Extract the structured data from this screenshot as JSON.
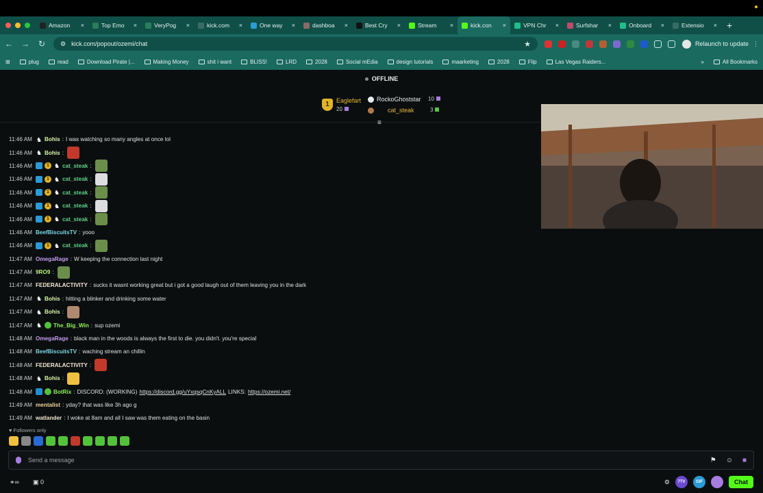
{
  "browser": {
    "tabs": [
      {
        "title": "Amazon",
        "favicon": "amazon-icon",
        "color": "#222222"
      },
      {
        "title": "Top Emo",
        "favicon": "video-icon",
        "color": "#2a7d5a"
      },
      {
        "title": "VeryPog",
        "favicon": "graph-icon",
        "color": "#2a7d5a"
      },
      {
        "title": "kick.com",
        "favicon": "globe-icon",
        "color": "#3a6a66"
      },
      {
        "title": "One way",
        "favicon": "plane-icon",
        "color": "#2a9bd6"
      },
      {
        "title": "dashboa",
        "favicon": "k-icon",
        "color": "#8a6a66"
      },
      {
        "title": "Best Cry",
        "favicon": "b-icon",
        "color": "#111111"
      },
      {
        "title": "Stream",
        "favicon": "kick-icon",
        "color": "#53fc18"
      },
      {
        "title": "kick.con",
        "favicon": "kick-icon",
        "color": "#53fc18",
        "active": true
      },
      {
        "title": "VPN Chr",
        "favicon": "p-icon",
        "color": "#1dbf8a"
      },
      {
        "title": "Surfshar",
        "favicon": "surfshark-icon",
        "color": "#c24a6a"
      },
      {
        "title": "Onboard",
        "favicon": "p-icon",
        "color": "#1dbf8a"
      },
      {
        "title": "Extensio",
        "favicon": "puzzle-icon",
        "color": "#3a6a66"
      }
    ],
    "url": "kick.com/popout/ozemi/chat",
    "relaunch_label": "Relaunch to update",
    "bookmarks": [
      "plug",
      "read",
      "Download Pirate |...",
      "Making Money",
      "shit i want",
      "BLISS!",
      "LRD",
      "2028",
      "Social mEdia",
      "design tutorials",
      "maarketing",
      "2028",
      "Flip",
      "Las Vegas Raiders..."
    ],
    "all_bookmarks_label": "All Bookmarks"
  },
  "status": "OFFLINE",
  "pinned": {
    "first": {
      "name": "Eaglefart",
      "count": "20",
      "rank": "1"
    },
    "second": {
      "name": "RockoGhoststar",
      "count": "10"
    },
    "third": {
      "name": "cat_steak",
      "count": "3"
    }
  },
  "messages": [
    {
      "time": "11:46 AM",
      "user": "Bohis",
      "color": "#d7f5a7",
      "badges": [
        "horse"
      ],
      "text": "I was watching so many angles at once lol",
      "emote": null
    },
    {
      "time": "11:46 AM",
      "user": "Bohis",
      "color": "#d7f5a7",
      "badges": [
        "horse"
      ],
      "text": "",
      "emote": "#c0392b"
    },
    {
      "time": "11:46 AM",
      "user": "cat_steak",
      "color": "#5ed18a",
      "badges": [
        "vip",
        "sub",
        "horse"
      ],
      "text": "",
      "emote": "#6b8f4a"
    },
    {
      "time": "11:46 AM",
      "user": "cat_steak",
      "color": "#5ed18a",
      "badges": [
        "vip",
        "sub",
        "horse"
      ],
      "text": "",
      "emote": "#dddddd"
    },
    {
      "time": "11:46 AM",
      "user": "cat_steak",
      "color": "#5ed18a",
      "badges": [
        "vip",
        "sub",
        "horse"
      ],
      "text": "",
      "emote": "#6b8f4a"
    },
    {
      "time": "11:46 AM",
      "user": "cat_steak",
      "color": "#5ed18a",
      "badges": [
        "vip",
        "sub",
        "horse"
      ],
      "text": "",
      "emote": "#dddddd"
    },
    {
      "time": "11:46 AM",
      "user": "cat_steak",
      "color": "#5ed18a",
      "badges": [
        "vip",
        "sub",
        "horse"
      ],
      "text": "",
      "emote": "#6b8f4a"
    },
    {
      "time": "11:46 AM",
      "user": "BeefBiscuitsTV",
      "color": "#7ad6e0",
      "badges": [],
      "text": "yooo",
      "emote": null
    },
    {
      "time": "11:46 AM",
      "user": "cat_steak",
      "color": "#5ed18a",
      "badges": [
        "vip",
        "sub",
        "horse"
      ],
      "text": "",
      "emote": "#6b8f4a"
    },
    {
      "time": "11:47 AM",
      "user": "OmegaRage",
      "color": "#c39cf0",
      "badges": [],
      "text": "W keeping the connection last night",
      "emote": null
    },
    {
      "time": "11:47 AM",
      "user": "9RO9",
      "color": "#b8f07a",
      "badges": [],
      "text": "",
      "emote": "#6b8f4a"
    },
    {
      "time": "11:47 AM",
      "user": "FEDERALACTIVITY",
      "color": "#f0e6d0",
      "badges": [],
      "text": "sucks it wasnt working great but i got a good laugh out of them leaving you in the dark",
      "emote": null
    },
    {
      "time": "11:47 AM",
      "user": "Bohis",
      "color": "#d7f5a7",
      "badges": [
        "horse"
      ],
      "text": "hitting a blinker and drinking some water",
      "emote": null
    },
    {
      "time": "11:47 AM",
      "user": "Bohis",
      "color": "#d7f5a7",
      "badges": [
        "horse"
      ],
      "text": "",
      "emote": "#b08a70"
    },
    {
      "time": "11:47 AM",
      "user": "The_Big_Win",
      "color": "#8ef05a",
      "badges": [
        "horse",
        "grn"
      ],
      "text": "sup ozemi",
      "emote": null
    },
    {
      "time": "11:48 AM",
      "user": "OmegaRage",
      "color": "#c39cf0",
      "badges": [],
      "text": "black man in the woods is always the first to die. you didn't. you're special",
      "emote": null
    },
    {
      "time": "11:48 AM",
      "user": "BeefBiscuitsTV",
      "color": "#7ad6e0",
      "badges": [],
      "text": "waching stream an chillin",
      "emote": null
    },
    {
      "time": "11:48 AM",
      "user": "FEDERALACTIVITY",
      "color": "#f0e6d0",
      "badges": [],
      "text": "",
      "emote": "#c0392b"
    },
    {
      "time": "11:48 AM",
      "user": "Bohis",
      "color": "#d7f5a7",
      "badges": [
        "horse"
      ],
      "text": "",
      "emote": "#f0c040"
    },
    {
      "time": "11:48 AM",
      "user": "BotRix",
      "color": "#8ef05a",
      "badges": [
        "bot",
        "grn"
      ],
      "text": "DISCORD: (WORKING)",
      "link1": "https://discord.gg/uYxqsqCnKyALL",
      "mid": "LINKS:",
      "link2": "https://ozemi.net/",
      "emote": null
    },
    {
      "time": "11:49 AM",
      "user": "mentalist",
      "color": "#f0d29a",
      "badges": [],
      "text": "yday? that was like 3h ago g",
      "emote": null
    },
    {
      "time": "11:49 AM",
      "user": "watlander",
      "color": "#f0e6d0",
      "badges": [],
      "text": "I woke at 8am and all I saw was them eating on the basin",
      "emote": null
    }
  ],
  "followers_only_label": "Followers only",
  "emote_bar": [
    "#f0c040",
    "#888888",
    "#2a6ad6",
    "#53c23b",
    "#53c23b",
    "#c0392b",
    "#53c23b",
    "#53c23b",
    "#53c23b",
    "#53c23b"
  ],
  "input": {
    "placeholder": "Send a message"
  },
  "bottom": {
    "viewer_count": "0",
    "chat_label": "Chat",
    "seven_tv": "7TV",
    "gif": "GIF"
  },
  "colors": {
    "accent": "#53fc18",
    "tabbar": "#0f4f47",
    "toolbar": "#1a6a60"
  }
}
